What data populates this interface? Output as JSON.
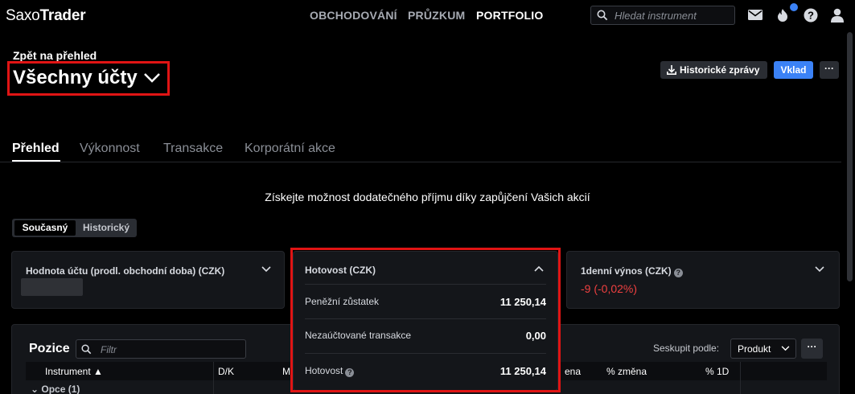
{
  "app": {
    "logo_light": "Saxo",
    "logo_bold": "Trader"
  },
  "nav": {
    "items": [
      "OBCHODOVÁNÍ",
      "PRŮZKUM",
      "PORTFOLIO"
    ],
    "active": "PORTFOLIO"
  },
  "search": {
    "placeholder": "Hledat instrument"
  },
  "header": {
    "back_label": "Zpět na přehled",
    "title": "Všechny účty",
    "historical_reports_label": "Historické zprávy",
    "deposit_label": "Vklad",
    "more_label": "···"
  },
  "tabs": [
    "Přehled",
    "Výkonnost",
    "Transakce",
    "Korporátní akce"
  ],
  "active_tab": "Přehled",
  "promo_text": "Získejte možnost dodatečného příjmu díky zapůjčení Vašich akcií",
  "period_toggle": {
    "options": [
      "Současný",
      "Historický"
    ],
    "active": "Současný"
  },
  "cards": {
    "account_value": {
      "title": "Hodnota účtu (prodl. obchodní doba) (CZK)"
    },
    "cash": {
      "title": "Hotovost (CZK)",
      "rows": [
        {
          "label": "Peněžní zůstatek",
          "value": "11 250,14"
        },
        {
          "label": "Nezaúčtované transakce",
          "value": "0,00"
        },
        {
          "label": "Hotovost",
          "value": "11 250,14"
        }
      ]
    },
    "daily_return": {
      "title": "1denní výnos (CZK)",
      "value": "-9 (-0,02%)"
    }
  },
  "positions": {
    "title": "Pozice",
    "filter_placeholder": "Filtr",
    "group_by_label": "Seskupit podle:",
    "group_by_value": "Produkt",
    "more_label": "···",
    "columns": [
      "Instrument ▲",
      "D/K",
      "M",
      "ena",
      "% změna",
      "% 1D"
    ],
    "group_row": "Opce (1)"
  },
  "colors": {
    "accent": "#3b82f6",
    "negative": "#ef4040",
    "highlight": "#e01414"
  }
}
